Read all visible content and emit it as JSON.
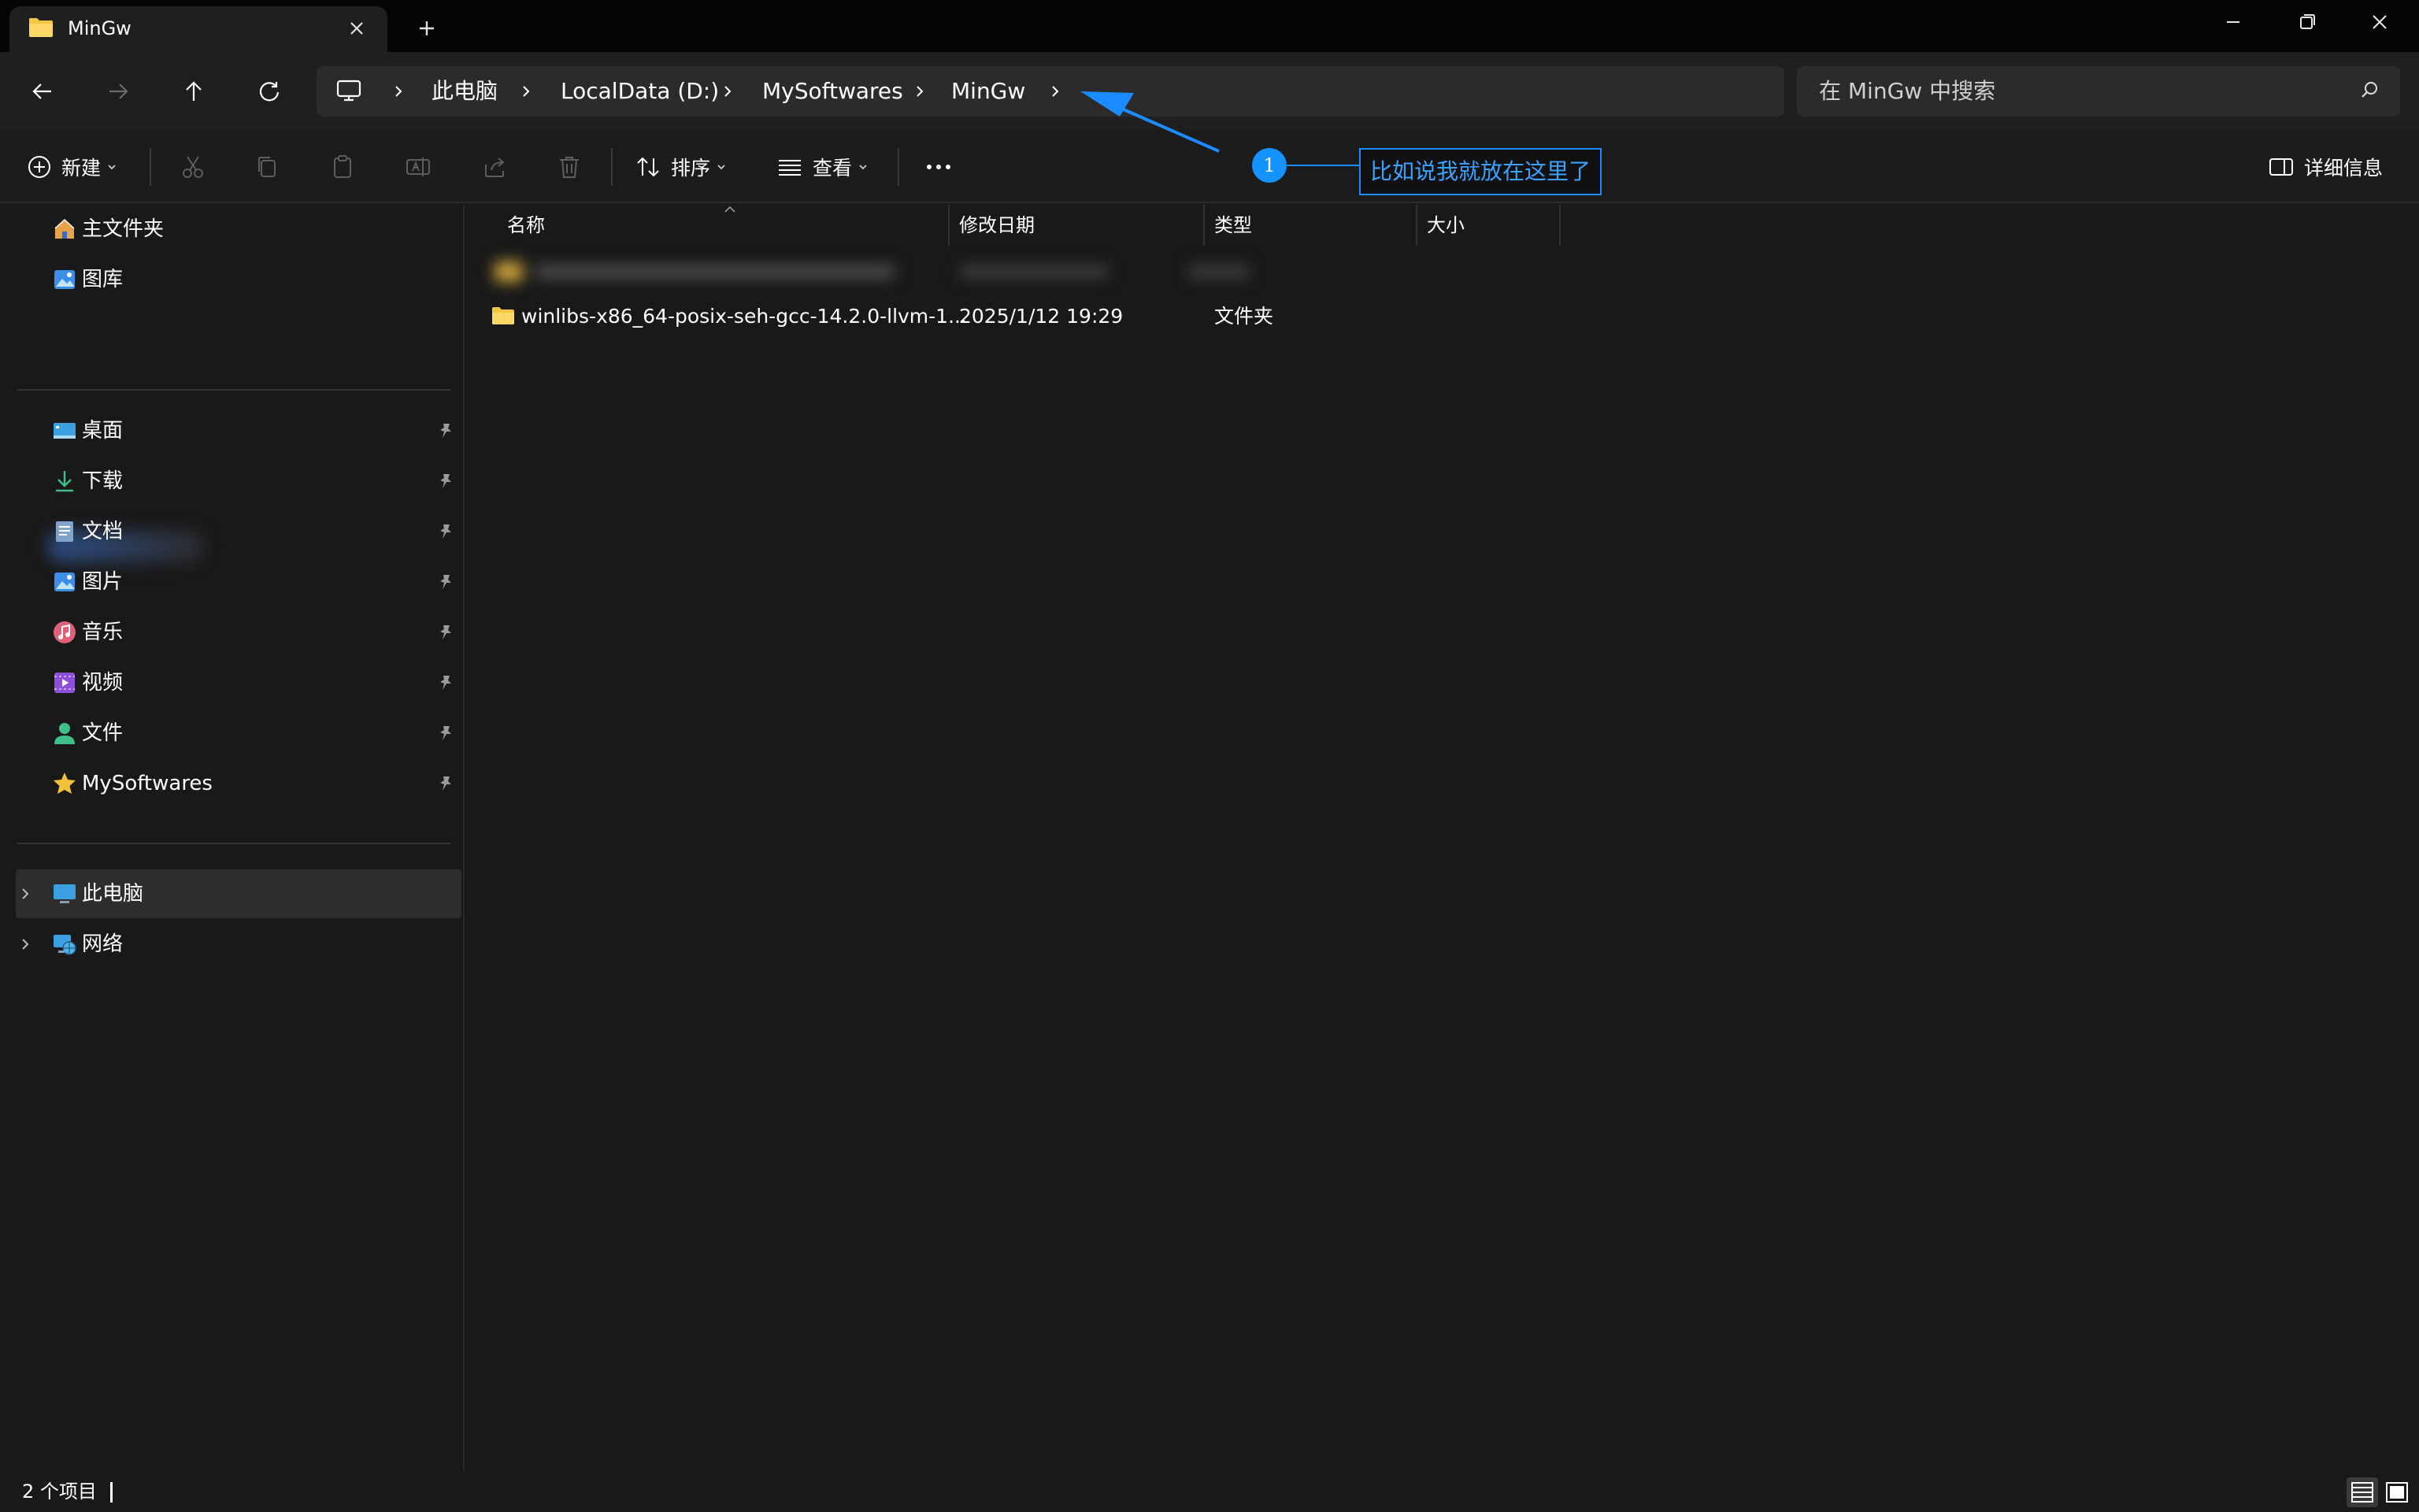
{
  "window": {
    "tab_title": "MinGw",
    "buttons": [
      "minimize-icon",
      "restore-icon",
      "close-icon"
    ]
  },
  "address": {
    "crumbs": [
      "此电脑",
      "LocalData (D:)",
      "MySoftwares",
      "MinGw"
    ],
    "search_placeholder": "在 MinGw 中搜索"
  },
  "commands": {
    "new_label": "新建",
    "sort_label": "排序",
    "view_label": "查看",
    "details_label": "详细信息"
  },
  "annotation": {
    "number": "1",
    "text": "比如说我就放在这里了",
    "color": "#1a8cff"
  },
  "sidebar": {
    "top_items": [
      {
        "label": "主文件夹",
        "icon": "home-icon"
      },
      {
        "label": "图库",
        "icon": "gallery-icon"
      }
    ],
    "pinned_items": [
      {
        "label": "桌面",
        "icon": "desktop-icon"
      },
      {
        "label": "下载",
        "icon": "download-icon"
      },
      {
        "label": "文档",
        "icon": "document-icon"
      },
      {
        "label": "图片",
        "icon": "pictures-icon"
      },
      {
        "label": "音乐",
        "icon": "music-icon"
      },
      {
        "label": "视频",
        "icon": "video-icon"
      },
      {
        "label": "文件",
        "icon": "user-files-icon"
      },
      {
        "label": "MySoftwares",
        "icon": "star-icon"
      }
    ],
    "locations": [
      {
        "label": "此电脑",
        "icon": "computer-icon"
      },
      {
        "label": "网络",
        "icon": "network-icon"
      }
    ]
  },
  "filelist": {
    "columns": [
      "名称",
      "修改日期",
      "类型",
      "大小"
    ],
    "rows": [
      {
        "name": "winlibs-x86_64-posix-seh-gcc-14.2.0-llvm-1...",
        "modified": "2025/1/12 19:29",
        "type": "文件夹",
        "size": ""
      }
    ]
  },
  "status": {
    "item_count": "2 个项目"
  }
}
